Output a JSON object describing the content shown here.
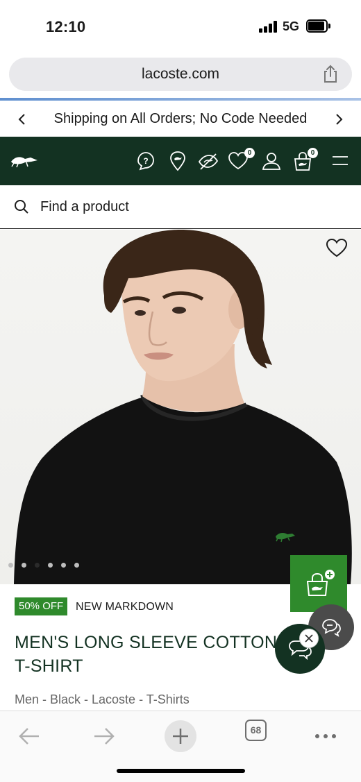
{
  "status_bar": {
    "time": "12:10",
    "network": "5G"
  },
  "browser": {
    "url": "lacoste.com",
    "tab_count": "68"
  },
  "promo": {
    "text": "Shipping on All Orders; No Code Needed"
  },
  "header": {
    "wishlist_count": "0",
    "bag_count": "0"
  },
  "search": {
    "placeholder": "Find a product"
  },
  "product": {
    "discount_badge": "50% OFF",
    "markdown_label": "NEW MARKDOWN",
    "title": "MEN'S LONG SLEEVE COTTON T-SHIRT",
    "breadcrumb": "Men - Black - Lacoste - T-Shirts",
    "image_count": 6,
    "active_image_index": 2
  },
  "icons": {
    "header": [
      "lacoste-logo-icon",
      "help-icon",
      "store-locator-icon",
      "hide-icon",
      "wishlist-icon",
      "account-icon",
      "bag-icon",
      "menu-icon"
    ],
    "toolbar": [
      "back-icon",
      "forward-icon",
      "new-tab-icon",
      "tabs-icon",
      "more-icon"
    ]
  },
  "colors": {
    "brand_green": "#133222",
    "sale_green": "#2f8a2c"
  }
}
